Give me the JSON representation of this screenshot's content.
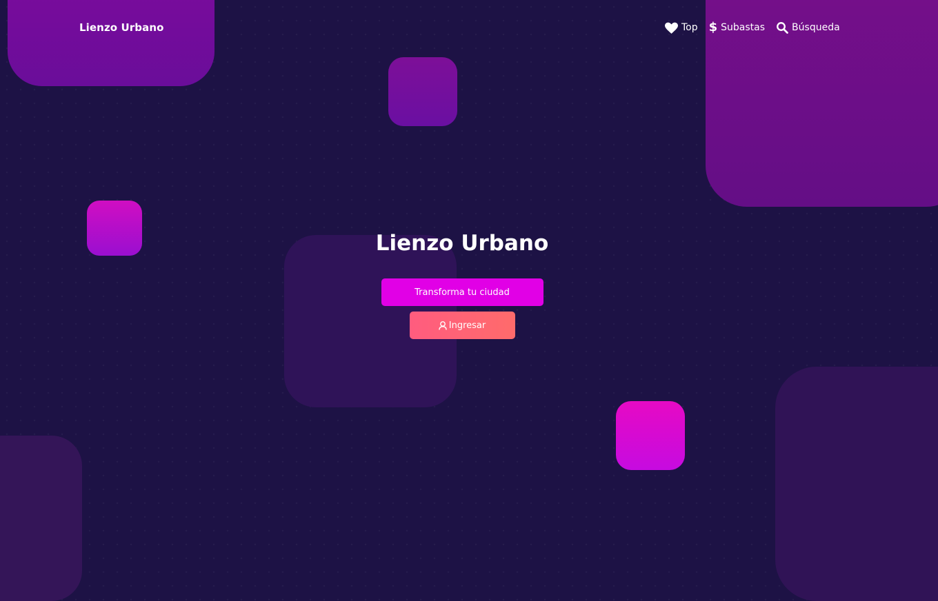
{
  "brand": {
    "name": "Lienzo Urbano"
  },
  "nav": {
    "items": [
      {
        "label": "Top",
        "icon": "heart-icon"
      },
      {
        "label": "Subastas",
        "icon": "dollar-icon"
      },
      {
        "label": "Búsqueda",
        "icon": "search-icon"
      }
    ]
  },
  "hero": {
    "title": "Lienzo Urbano",
    "primary_button": "Transforma tu ciudad",
    "login_button": "Ingresar",
    "login_icon": "user-icon"
  },
  "colors": {
    "background": "#1d1245",
    "primary_button": "#e100e6",
    "login_button": "#ff6275",
    "accent_purple": "#6a0d9a",
    "accent_magenta": "#e60ac4"
  }
}
